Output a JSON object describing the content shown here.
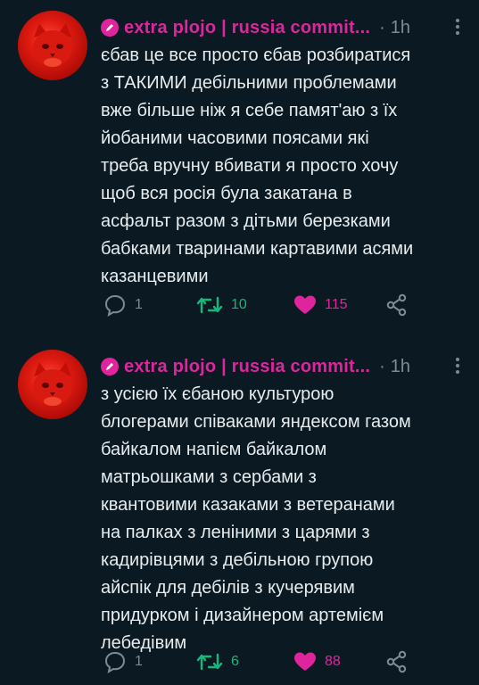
{
  "tweets": [
    {
      "author": "extra plojo | russia commit...",
      "dot": "·",
      "time": "1h",
      "text": "єбав це все просто єбав розбиратися\nз ТАКИМИ дебільними проблемами\nвже більше ніж я себе памят'аю з їх\nйобаними часовими поясами які\nтреба вручну вбивати я просто хочу\nщоб вся росія була закатана в\nасфальт разом з  дітьми березками\nбабками тваринами картавими асями\nказанцевими",
      "replies": "1",
      "retweets": "10",
      "likes": "115"
    },
    {
      "author": "extra plojo | russia commit...",
      "dot": "·",
      "time": "1h",
      "text": "з усією їх єбаною культурою\nблогерами співаками яндексом газом\nбайкалом напієм байкалом\nматрьошками з сербами з\nквантовими казаками з ветеранами\nна палках з леніними з царями з\nкадирівцями з дебільною групою\nайспік для дебілів з кучерявим\nпридурком і дизайнером артемієм\nлебедівим",
      "replies": "1",
      "retweets": "6",
      "likes": "88"
    }
  ],
  "icons": {
    "author_badge": "pencil-icon",
    "more": "more-vertical-icon",
    "reply": "comment-icon",
    "retweet": "retweet-icon",
    "like": "heart-icon",
    "share": "share-icon"
  },
  "colors": {
    "background": "#0b1a22",
    "name": "#e0249d",
    "muted": "#7d8b95",
    "retweet": "#14b87a",
    "like": "#e0249d",
    "text": "#e7ecef"
  }
}
